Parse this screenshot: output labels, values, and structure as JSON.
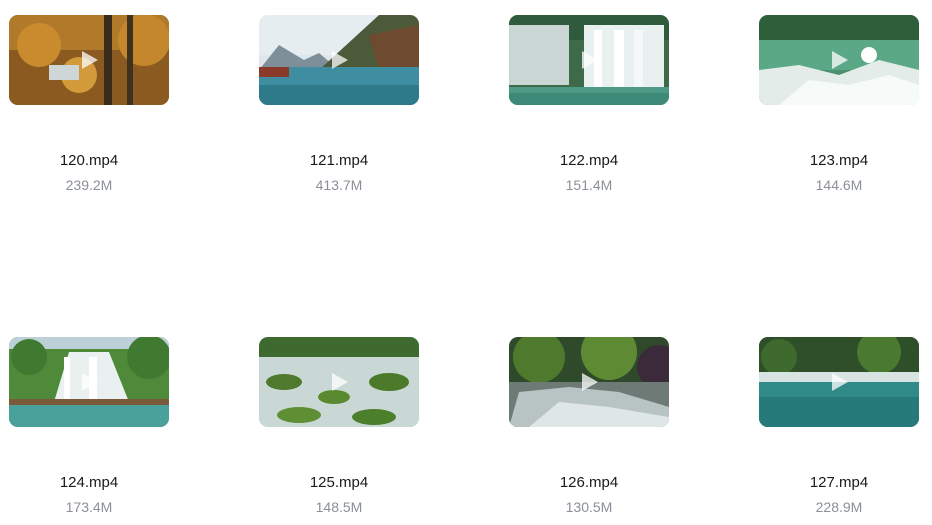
{
  "files": [
    {
      "name": "120.mp4",
      "size": "239.2M",
      "thumbnail": "autumn-forest-stream",
      "icon": "play-icon"
    },
    {
      "name": "121.mp4",
      "size": "413.7M",
      "thumbnail": "mountain-lake",
      "icon": "play-icon"
    },
    {
      "name": "122.mp4",
      "size": "151.4M",
      "thumbnail": "large-waterfall",
      "icon": "play-icon"
    },
    {
      "name": "123.mp4",
      "size": "144.6M",
      "thumbnail": "river-rapids",
      "icon": "play-icon"
    },
    {
      "name": "124.mp4",
      "size": "173.4M",
      "thumbnail": "waterfall-with-walkway",
      "icon": "play-icon"
    },
    {
      "name": "125.mp4",
      "size": "148.5M",
      "thumbnail": "mossy-rocks-stream",
      "icon": "play-icon"
    },
    {
      "name": "126.mp4",
      "size": "130.5M",
      "thumbnail": "forest-creek",
      "icon": "play-icon"
    },
    {
      "name": "127.mp4",
      "size": "228.9M",
      "thumbnail": "turquoise-river",
      "icon": "play-icon"
    }
  ]
}
